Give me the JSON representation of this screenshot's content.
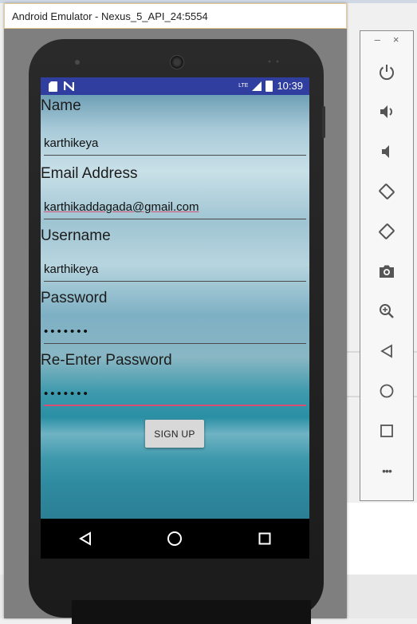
{
  "window": {
    "title": "Android Emulator - Nexus_5_API_24:5554"
  },
  "statusbar": {
    "time": "10:39",
    "network": "LTE"
  },
  "form": {
    "name_label": "Name",
    "name_value": "karthikeya",
    "email_label": "Email Address",
    "email_value": "karthikaddagada@gmail.com",
    "username_label": "Username",
    "username_value": "karthikeya",
    "password_label": "Password",
    "password_value": "•••••••",
    "reenter_label": "Re-Enter Password",
    "reenter_value": "•••••••",
    "signup_label": "SIGN UP"
  },
  "toolbar": {
    "minimize": "–",
    "close": "×",
    "more": "•••"
  },
  "colors": {
    "status_bar": "#303f9f",
    "focus_underline": "#d84f73",
    "toolbar_icon": "#555555"
  }
}
